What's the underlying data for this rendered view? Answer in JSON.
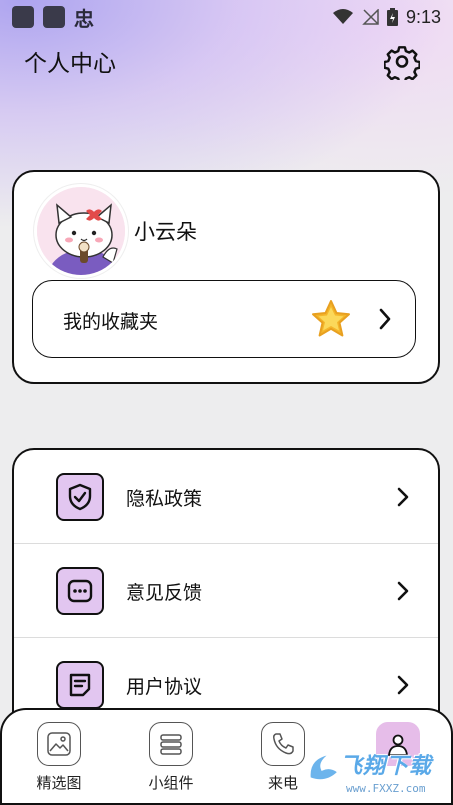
{
  "status_bar": {
    "left_glyph": "忠",
    "time": "9:13"
  },
  "header": {
    "title": "个人中心",
    "settings_icon": "gear-icon"
  },
  "profile": {
    "username": "小云朵",
    "favorites_label": "我的收藏夹"
  },
  "menu": {
    "items": [
      {
        "label": "隐私政策",
        "icon": "shield-check-icon"
      },
      {
        "label": "意见反馈",
        "icon": "chat-dots-icon"
      },
      {
        "label": "用户协议",
        "icon": "document-icon"
      }
    ]
  },
  "bottom_nav": {
    "items": [
      {
        "label": "精选图",
        "icon": "image-icon"
      },
      {
        "label": "小组件",
        "icon": "widget-icon"
      },
      {
        "label": "来电",
        "icon": "phone-icon"
      },
      {
        "label": "",
        "icon": "user-icon",
        "active": true
      }
    ]
  },
  "watermark": {
    "text": "飞翔下载",
    "sub": "www.FXXZ.com"
  },
  "colors": {
    "accent": "#e2c6f0",
    "nav_active": "#e6bde9",
    "star": "#f7c531"
  }
}
